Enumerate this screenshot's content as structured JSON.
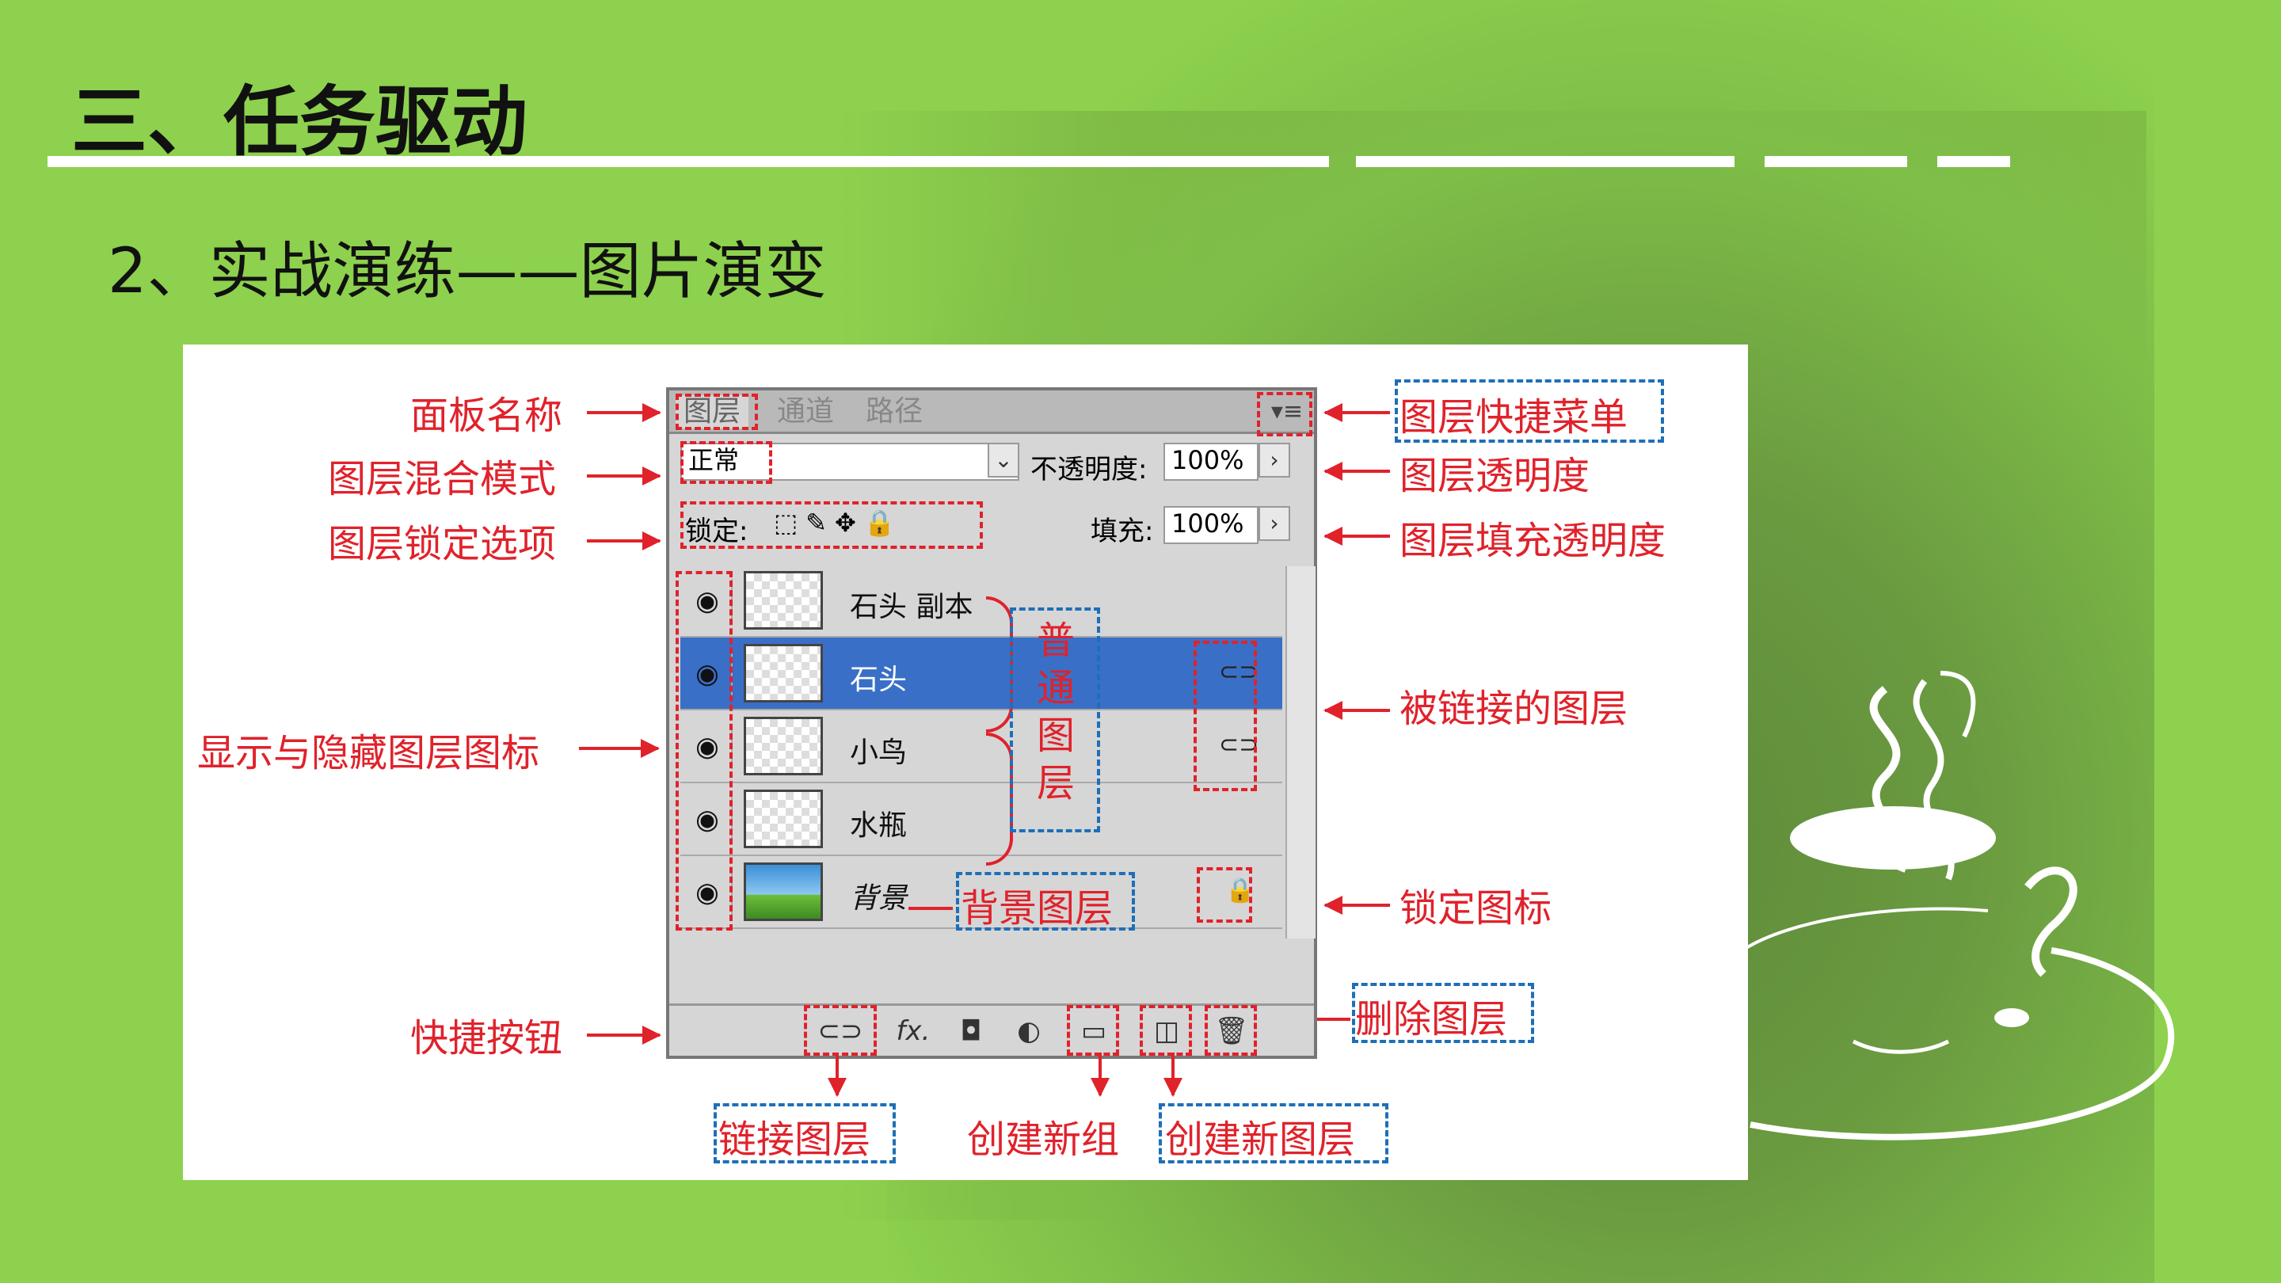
{
  "slide": {
    "heading": "三、任务驱动",
    "subheading": "2、实战演练——图片演变"
  },
  "panel": {
    "tabs": [
      "图层",
      "通道",
      "路径"
    ],
    "menu_icon": "panel-menu-icon",
    "blend_mode": "正常",
    "opacity_label": "不透明度:",
    "opacity_value": "100%",
    "lock_label": "锁定:",
    "fill_label": "填充:",
    "fill_value": "100%",
    "layers": [
      {
        "name": "石头 副本",
        "selected": false,
        "linked": false
      },
      {
        "name": "石头",
        "selected": true,
        "linked": true
      },
      {
        "name": "小鸟",
        "selected": false,
        "linked": true
      },
      {
        "name": "水瓶",
        "selected": false,
        "linked": false
      },
      {
        "name": "背景",
        "selected": false,
        "linked": false,
        "locked": true
      }
    ],
    "bottom_fx": "fx."
  },
  "annotations": {
    "panel_name": "面板名称",
    "blend_mode": "图层混合模式",
    "lock_options": "图层锁定选项",
    "show_hide": "显示与隐藏图层图标",
    "quick_buttons": "快捷按钮",
    "quick_menu": "图层快捷菜单",
    "layer_opacity": "图层透明度",
    "layer_fill_opacity": "图层填充透明度",
    "linked_layers": "被链接的图层",
    "lock_icon": "锁定图标",
    "delete_layer": "删除图层",
    "normal_layers": "普通图层",
    "background_layer": "背景图层",
    "link_layers": "链接图层",
    "new_group": "创建新组",
    "new_layer": "创建新图层"
  }
}
